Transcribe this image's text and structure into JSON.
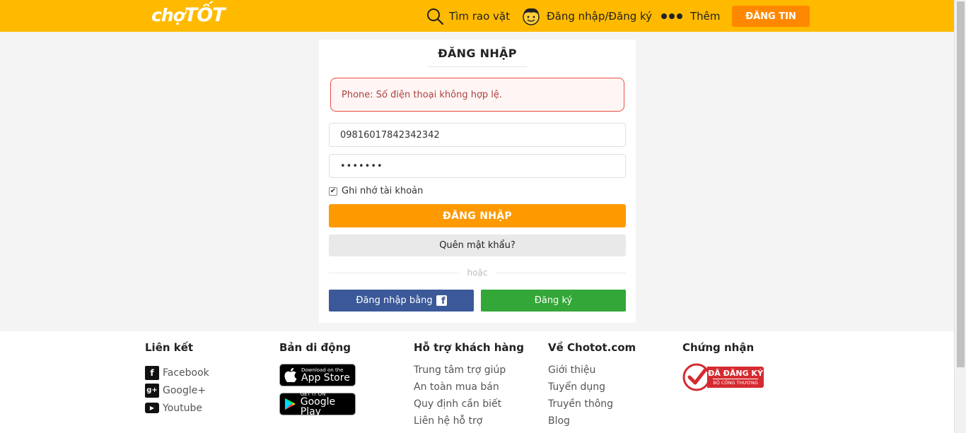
{
  "header": {
    "logo_left": "chợ",
    "logo_right": "TỐT",
    "search_label": "Tìm rao vặt",
    "login_label": "Đăng nhập/Đăng ký",
    "more_label": "Thêm",
    "post_label": "ĐĂNG TIN",
    "bg_color": "#ffba00",
    "post_color": "#ff8800"
  },
  "login": {
    "title": "ĐĂNG NHẬP",
    "error": "Phone: Số điện thoại không hợp lệ.",
    "phone_value": "09816017842342342",
    "password_mask": "•••••••",
    "remember_label": "Ghi nhớ tài khoản",
    "remember_checked": true,
    "submit_label": "ĐĂNG NHẬP",
    "forgot_label": "Quên mật khẩu?",
    "or_label": "hoặc",
    "facebook_label": "Đăng nhập bằng",
    "register_label": "Đăng ký",
    "submit_color": "#fe9900",
    "facebook_color": "#3b5998",
    "register_color": "#33a737"
  },
  "footer": {
    "links": {
      "title": "Liên kết",
      "items": [
        "Facebook",
        "Google+",
        "Youtube"
      ]
    },
    "app": {
      "title": "Bản di động",
      "appstore_small": "Download on the",
      "appstore_big": "App Store",
      "googleplay_small": "GET IT ON",
      "googleplay_big": "Google Play"
    },
    "help": {
      "title": "Hỗ trợ khách hàng",
      "items": [
        "Trung tâm trợ giúp",
        "An toàn mua bán",
        "Quy định cần biết",
        "Liên hệ hỗ trợ"
      ]
    },
    "about": {
      "title": "Về Chotot.com",
      "items": [
        "Giới thiệu",
        "Tuyển dụng",
        "Truyền thông",
        "Blog"
      ]
    },
    "cert": {
      "title": "Chứng nhận",
      "badge_main": "ĐÃ ĐĂNG KÝ",
      "badge_sub": "BỘ CÔNG THƯƠNG"
    }
  }
}
